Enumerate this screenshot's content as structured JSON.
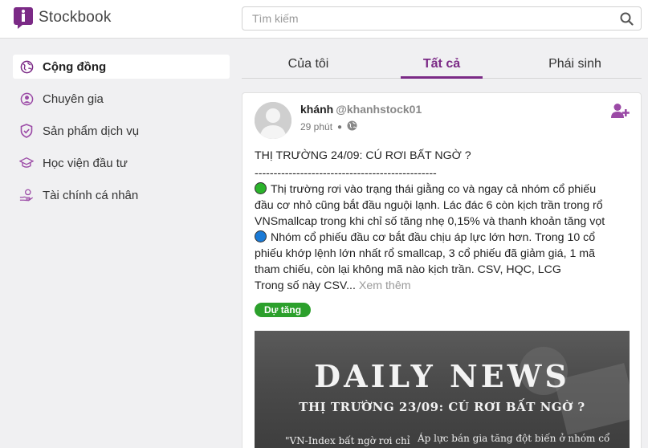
{
  "app": {
    "name": "Stockbook",
    "brand_color": "#7b2a86"
  },
  "search": {
    "placeholder": "Tìm kiếm",
    "icon": "search-icon"
  },
  "sidebar": {
    "items": [
      {
        "label": "Cộng đồng",
        "icon": "globe-icon",
        "active": true
      },
      {
        "label": "Chuyên gia",
        "icon": "user-icon",
        "active": false
      },
      {
        "label": "Sản phẩm dịch vụ",
        "icon": "shield-check-icon",
        "active": false
      },
      {
        "label": "Học viện đầu tư",
        "icon": "graduation-cap-icon",
        "active": false
      },
      {
        "label": "Tài chính cá nhân",
        "icon": "hand-money-icon",
        "active": false
      }
    ]
  },
  "tabs": [
    {
      "label": "Của tôi",
      "active": false
    },
    {
      "label": "Tất cả",
      "active": true
    },
    {
      "label": "Phái sinh",
      "active": false
    }
  ],
  "post": {
    "author_name": "khánh",
    "author_handle": "@khanhstock01",
    "time": "29 phút",
    "visibility_icon": "globe-icon",
    "title": "THỊ TRƯỜNG 24/09: CÚ RƠI BẤT NGỜ ?",
    "divider": "------------------------------------------------",
    "lines": [
      "Thị trường rơi vào trạng thái giằng co và ngay cả nhóm cổ phiếu",
      "đầu cơ nhỏ cũng bắt đầu nguội lạnh. Lác đác 6 còn kịch trần trong rổ",
      "VNSmallcap trong khi chỉ số tăng nhẹ 0,15% và thanh khoản tăng vọt",
      "Nhóm cổ phiếu đầu cơ bắt đầu chịu áp lực lớn hơn. Trong 10 cổ",
      "phiếu khớp lệnh lớn nhất rổ smallcap, 3 cổ phiếu đã giảm giá, 1 mã",
      "tham chiếu, còn lại không mã nào kịch trần. CSV, HQC, LCG",
      "Trong số này CSV..."
    ],
    "see_more": "Xem thêm",
    "tag": "Dự tăng",
    "image": {
      "title": "DAILY NEWS",
      "subtitle": "THỊ TRƯỜNG 23/09: CÚ RƠI BẤT NGỜ ?",
      "left_caption": "\"VN-Index bất ngờ rơi chỉ",
      "right_caption": "Áp lực bán gia tăng đột biến ở nhóm cổ"
    }
  }
}
